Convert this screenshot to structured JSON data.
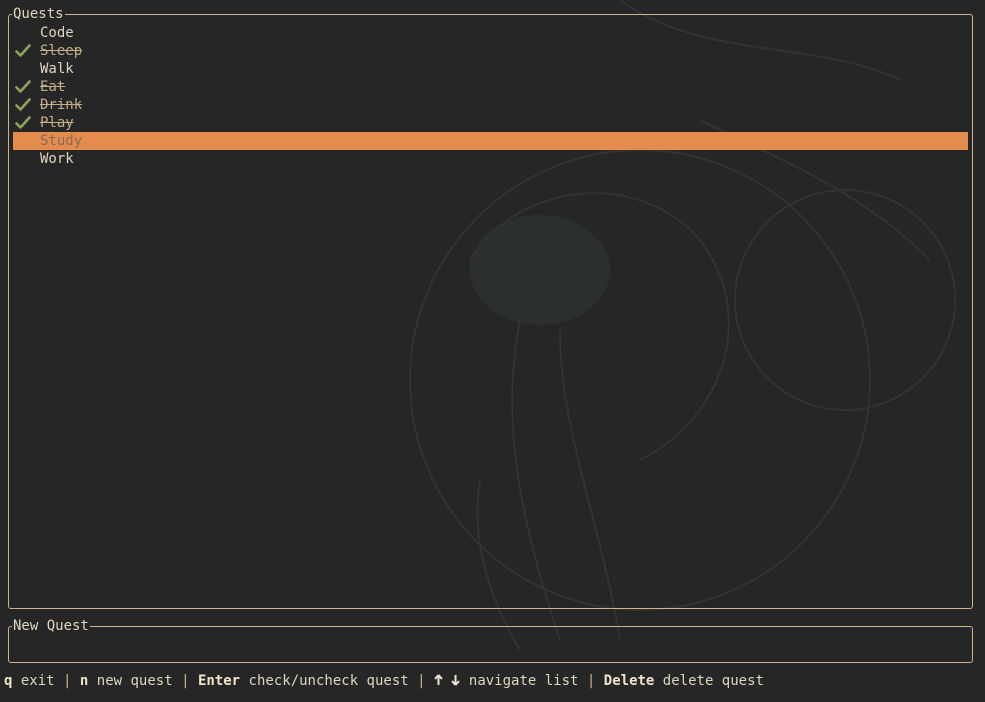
{
  "colors": {
    "background": "#262626",
    "border": "#cdb48f",
    "text": "#dfd6bf",
    "check": "#8fa35c",
    "selected_bg": "#e48b4e"
  },
  "quests_panel": {
    "title": "Quests",
    "items": [
      {
        "label": "Code",
        "done": false,
        "selected": false
      },
      {
        "label": "Sleep",
        "done": true,
        "selected": false
      },
      {
        "label": "Walk",
        "done": false,
        "selected": false
      },
      {
        "label": "Eat",
        "done": true,
        "selected": false
      },
      {
        "label": "Drink",
        "done": true,
        "selected": false
      },
      {
        "label": "Play",
        "done": true,
        "selected": false
      },
      {
        "label": "Study",
        "done": false,
        "selected": true
      },
      {
        "label": "Work",
        "done": false,
        "selected": false
      }
    ],
    "check_icon": "checkmark-icon"
  },
  "new_quest_panel": {
    "title": "New Quest",
    "value": ""
  },
  "helpbar": {
    "exit_key": "q",
    "exit_label": "exit",
    "new_key": "n",
    "new_label": "new quest",
    "check_key": "Enter",
    "check_label": "check/uncheck quest",
    "nav_icons": [
      "arrow-up-icon",
      "arrow-down-icon"
    ],
    "nav_label": "navigate list",
    "delete_key": "Delete",
    "delete_label": "delete quest",
    "separator": "|"
  }
}
